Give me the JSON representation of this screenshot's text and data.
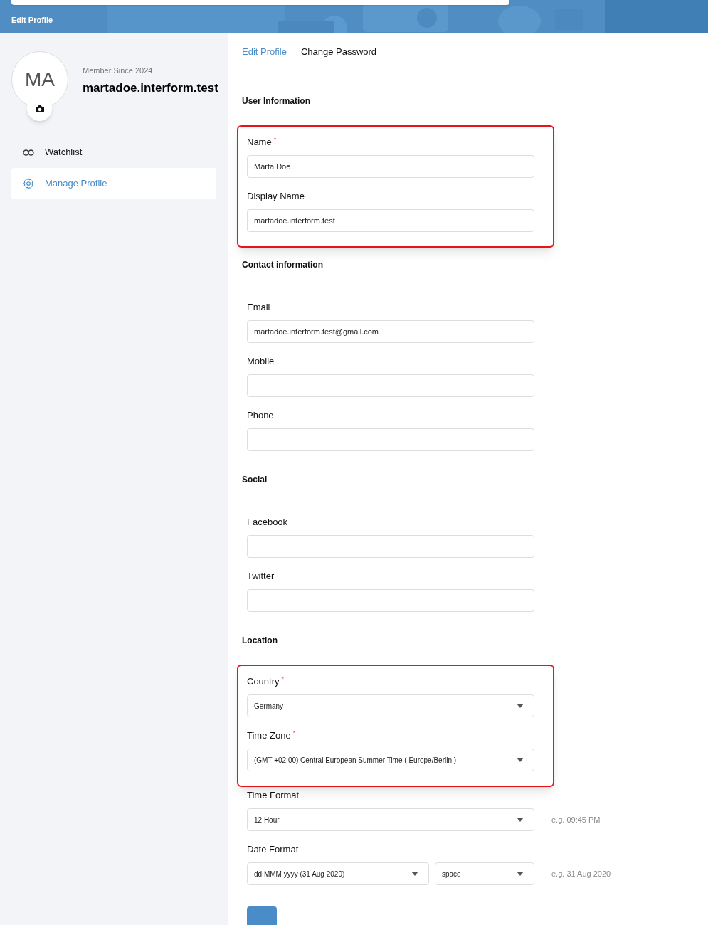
{
  "header": {
    "title": "Edit Profile"
  },
  "profile": {
    "initials": "MA",
    "member_since": "Member Since 2024",
    "username": "martadoe.interform.test"
  },
  "menu": [
    {
      "label": "Watchlist",
      "selected": false
    },
    {
      "label": "Manage Profile",
      "selected": true
    }
  ],
  "tabs": [
    {
      "label": "Edit Profile",
      "selected": true
    },
    {
      "label": "Change Password",
      "selected": false
    }
  ],
  "sections": [
    {
      "title": "User Information",
      "groups": [
        {
          "highlighted": true,
          "fields": [
            {
              "kind": "input",
              "label": "Name",
              "required_mark": "*",
              "value": "Marta Doe"
            },
            {
              "kind": "input",
              "label": "Display Name",
              "value": "martadoe.interform.test"
            }
          ]
        }
      ]
    },
    {
      "title": "Contact information",
      "groups": [
        {
          "highlighted": false,
          "fields": [
            {
              "kind": "input",
              "label": "Email",
              "value": "martadoe.interform.test@gmail.com"
            },
            {
              "kind": "input",
              "label": "Mobile"
            },
            {
              "kind": "input",
              "label": "Phone"
            }
          ]
        }
      ]
    },
    {
      "title": "Social",
      "groups": [
        {
          "highlighted": false,
          "fields": [
            {
              "kind": "input",
              "label": "Facebook"
            },
            {
              "kind": "input",
              "label": "Twitter"
            }
          ]
        }
      ]
    },
    {
      "title": "Location",
      "groups": [
        {
          "highlighted": true,
          "fields": [
            {
              "kind": "select",
              "label": "Country",
              "required_mark": "*",
              "value": "Germany"
            },
            {
              "kind": "select",
              "label": "Time Zone",
              "required_mark": "*",
              "value": "(GMT +02:00) Central European Summer Time ( Europe/Berlin )"
            }
          ]
        },
        {
          "highlighted": false,
          "fields": [
            {
              "kind": "select",
              "label": "Time Format",
              "value": "12 Hour",
              "hint": "e.g. 09:45 PM"
            },
            {
              "kind": "select_pair",
              "label": "Date Format",
              "values": [
                "dd MMM yyyy (31 Aug 2020)",
                "space"
              ],
              "hint": "e.g. 31 Aug 2020"
            }
          ]
        }
      ]
    }
  ]
}
